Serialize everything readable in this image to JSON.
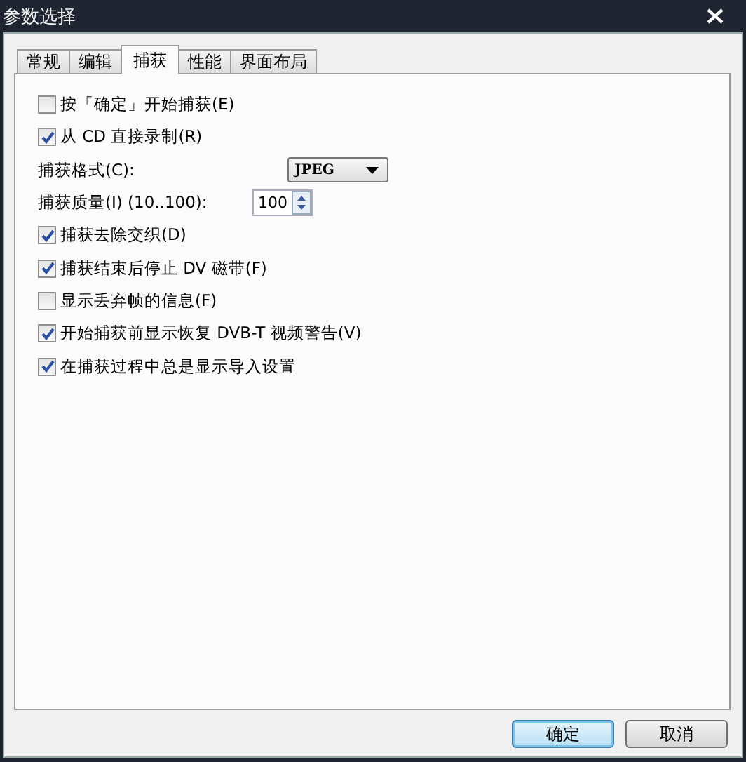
{
  "window": {
    "title": "参数选择"
  },
  "tabs": [
    {
      "label": "常规",
      "selected": false
    },
    {
      "label": "编辑",
      "selected": false
    },
    {
      "label": "捕获",
      "selected": true
    },
    {
      "label": "性能",
      "selected": false
    },
    {
      "label": "界面布局",
      "selected": false
    }
  ],
  "options": [
    {
      "kind": "checkbox",
      "label": "按「确定」开始捕获(E)",
      "checked": false
    },
    {
      "kind": "checkbox",
      "label": "从 CD 直接录制(R)",
      "checked": true
    },
    {
      "kind": "select",
      "label": "捕获格式(C):",
      "value": "JPEG"
    },
    {
      "kind": "spinner",
      "label": "捕获质量(I) (10..100):",
      "value": "100"
    },
    {
      "kind": "checkbox",
      "label": "捕获去除交织(D)",
      "checked": true
    },
    {
      "kind": "checkbox",
      "label": "捕获结束后停止 DV 磁带(F)",
      "checked": true
    },
    {
      "kind": "checkbox",
      "label": "显示丢弃帧的信息(F)",
      "checked": false
    },
    {
      "kind": "checkbox",
      "label": "开始捕获前显示恢复 DVB-T 视频警告(V)",
      "checked": true
    },
    {
      "kind": "checkbox",
      "label": "在捕获过程中总是显示导入设置",
      "checked": true
    }
  ],
  "buttons": [
    {
      "label": "确定",
      "default": true
    },
    {
      "label": "取消",
      "default": false
    }
  ]
}
